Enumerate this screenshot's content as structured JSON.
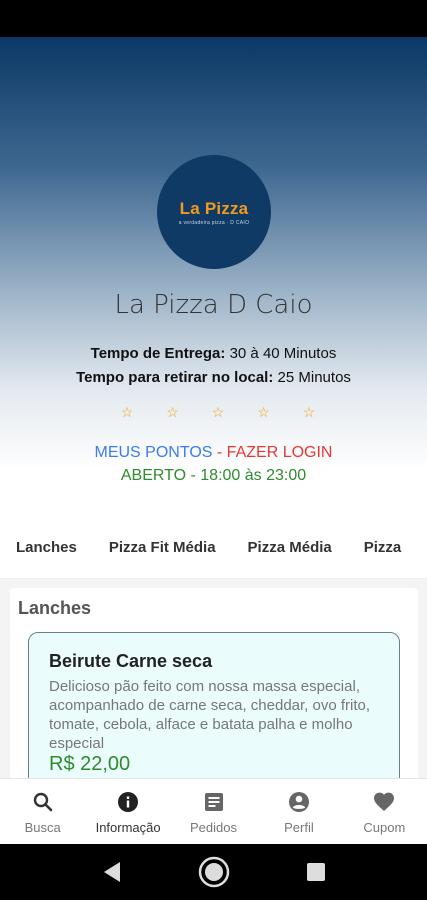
{
  "store": {
    "logo_text": "La Pizza",
    "logo_sub": "a verdadeira pizza · D CAIO",
    "name": "La Pizza D Caio",
    "delivery_label": "Tempo de Entrega:",
    "delivery_value": "30 à 40 Minutos",
    "pickup_label": "Tempo para retirar no local:",
    "pickup_value": "25 Minutos",
    "rating_stars": 5,
    "star_glyph": "☆",
    "points_label": "MEUS PONTOS",
    "login_label": "- FAZER LOGIN",
    "open_status": "ABERTO - 18:00 às 23:00"
  },
  "tabs": [
    {
      "label": "Lanches"
    },
    {
      "label": "Pizza Fit Média"
    },
    {
      "label": "Pizza Média"
    },
    {
      "label": "Pizza"
    }
  ],
  "section": {
    "title": "Lanches",
    "product": {
      "name": "Beirute Carne seca",
      "description": "Delicioso pão feito com nossa massa especial, acompanhado de carne seca, cheddar, ovo frito, tomate, cebola, alface e batata palha e molho especial",
      "price": "R$ 22,00"
    }
  },
  "bottom_nav": [
    {
      "label": "Busca",
      "icon": "search-icon"
    },
    {
      "label": "Informação",
      "icon": "info-icon"
    },
    {
      "label": "Pedidos",
      "icon": "orders-icon"
    },
    {
      "label": "Perfil",
      "icon": "profile-icon"
    },
    {
      "label": "Cupom",
      "icon": "heart-icon"
    }
  ],
  "colors": {
    "header_top": "#0b3866",
    "points_blue": "#3b7cf0",
    "login_red": "#e53935",
    "open_green": "#2e8b2e",
    "star": "#f0a400",
    "logo_orange": "#f39a1c"
  }
}
